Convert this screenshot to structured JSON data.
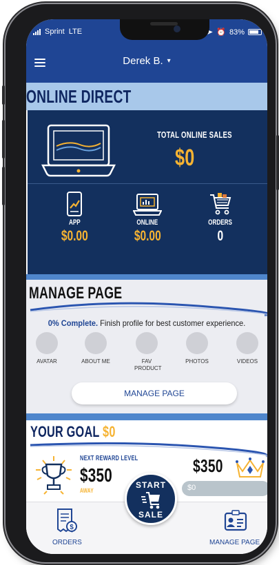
{
  "status_bar": {
    "carrier": "Sprint",
    "network": "LTE",
    "battery": "83%"
  },
  "header": {
    "user_name": "Derek B.",
    "caret": "▾"
  },
  "online_direct": {
    "title": "ONLINE DIRECT",
    "total_label": "TOTAL ONLINE SALES",
    "total_value": "$0",
    "stats": [
      {
        "label": "APP",
        "value": "$0.00"
      },
      {
        "label": "ONLINE",
        "value": "$0.00"
      },
      {
        "label": "ORDERS",
        "value": "0"
      }
    ]
  },
  "manage_page": {
    "title": "MANAGE PAGE",
    "complete_percent": "0% Complete.",
    "complete_note": " Finish profile for best customer experience.",
    "items": [
      {
        "label": "AVATAR"
      },
      {
        "label": "ABOUT ME"
      },
      {
        "label": "FAV PRODUCT"
      },
      {
        "label": "PHOTOS"
      },
      {
        "label": "VIDEOS"
      }
    ],
    "button_label": "MANAGE PAGE"
  },
  "goal": {
    "title": "YOUR GOAL",
    "amount": "$0",
    "next_reward_label": "NEXT REWARD LEVEL",
    "next_reward_amount": "$350",
    "away_label": "AWAY",
    "goal_amount": "$350",
    "progress_text": "$0",
    "progress_fraction": 0
  },
  "start_sale": {
    "line1": "START",
    "line2": "SALE"
  },
  "bottom_nav": {
    "orders_label": "ORDERS",
    "manage_label": "MANAGE PAGE"
  },
  "colors": {
    "primary": "#1f4594",
    "dark_navy": "#13305e",
    "gold": "#f6b332",
    "light_blue": "#a8c8ea"
  }
}
